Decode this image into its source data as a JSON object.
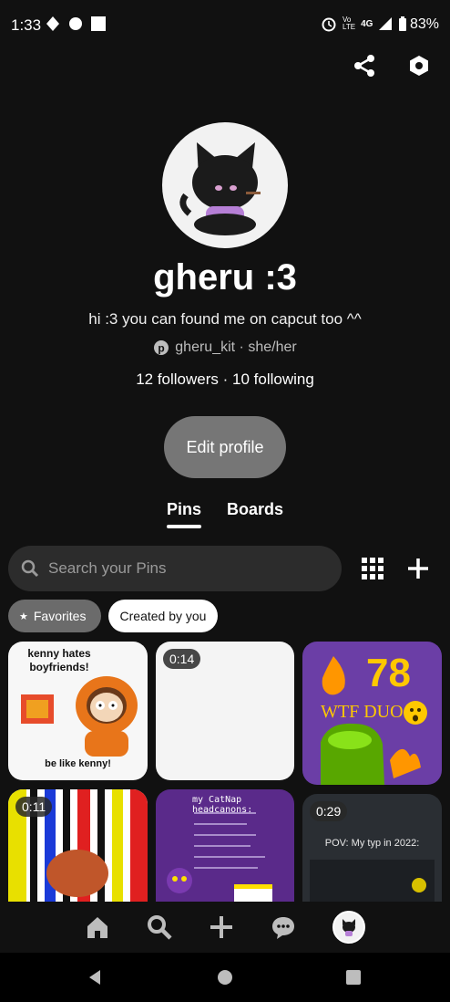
{
  "status_bar": {
    "time": "1:33",
    "battery": "83%",
    "network": "4G"
  },
  "profile": {
    "name": "gheru :3",
    "bio": "hi :3 you can found me on capcut too ^^",
    "handle": "gheru_kit",
    "pronouns": " · she/her",
    "followers_text": "12 followers",
    "following_text": " · 10 following",
    "edit_label": "Edit profile"
  },
  "tabs": {
    "pins": "Pins",
    "boards": "Boards"
  },
  "search": {
    "placeholder": "Search your Pins"
  },
  "filters": {
    "favorites": "Favorites",
    "created": "Created by you"
  },
  "pins": {
    "p1": {
      "top_text": "kenny hates boyfriends!",
      "bottom_text": "be like kenny!"
    },
    "p2": {
      "duration": "0:14"
    },
    "p3": {
      "number": "78",
      "subtitle": "WTF DUO"
    },
    "p4": {
      "duration": "0:11"
    },
    "p5": {
      "title": "my CatNap headcanons:"
    },
    "p6": {
      "duration": "0:29",
      "caption": "POV: My typ in 2022:"
    }
  },
  "colors": {
    "accent_orange": "#e8751a",
    "duo_purple": "#6b3ea6",
    "bg": "#111111"
  }
}
